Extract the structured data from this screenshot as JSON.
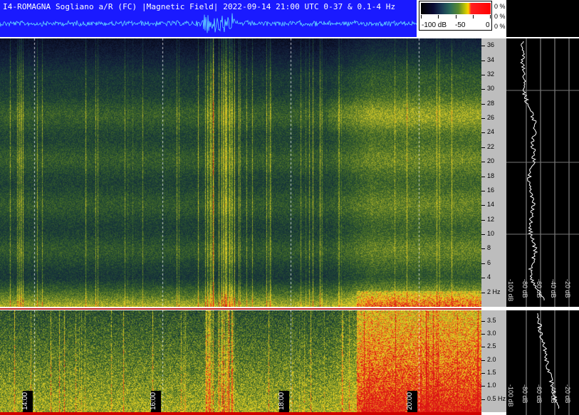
{
  "header": {
    "title": "I4-ROMAGNA  Sogliano a/R (FC) |Magnetic Field| 2022-09-14 21:00 UTC 0-37 & 0.1-4 Hz"
  },
  "colorbar": {
    "min_label": "-100 dB",
    "mid_label": "-50",
    "max_label": "0",
    "percent_labels": [
      "0 %",
      "0 %",
      "0 %"
    ],
    "colors": [
      "#000000",
      "#1a3a55",
      "#5a8a30",
      "#ffd000",
      "#ff0000"
    ]
  },
  "freq_axis_top": {
    "labels": [
      "36",
      "34",
      "32",
      "30",
      "28",
      "26",
      "24",
      "22",
      "20",
      "18",
      "16",
      "14",
      "12",
      "10",
      "8",
      "6",
      "4",
      "2 Hz"
    ],
    "values": [
      36,
      34,
      32,
      30,
      28,
      26,
      24,
      22,
      20,
      18,
      16,
      14,
      12,
      10,
      8,
      6,
      4,
      2
    ]
  },
  "freq_axis_bottom": {
    "labels": [
      "3.5",
      "3.0",
      "2.5",
      "2.0",
      "1.5",
      "1.0",
      "0.5 Hz"
    ],
    "values": [
      3.5,
      3.0,
      2.5,
      2.0,
      1.5,
      1.0,
      0.5
    ]
  },
  "time_axis": {
    "labels": [
      "14:00",
      "16:00",
      "18:00",
      "20:00"
    ]
  },
  "spectrum_panel": {
    "db_labels": [
      "-100 dB",
      "-80 dB",
      "-60 dB",
      "-40 dB",
      "-20 dB"
    ]
  }
}
